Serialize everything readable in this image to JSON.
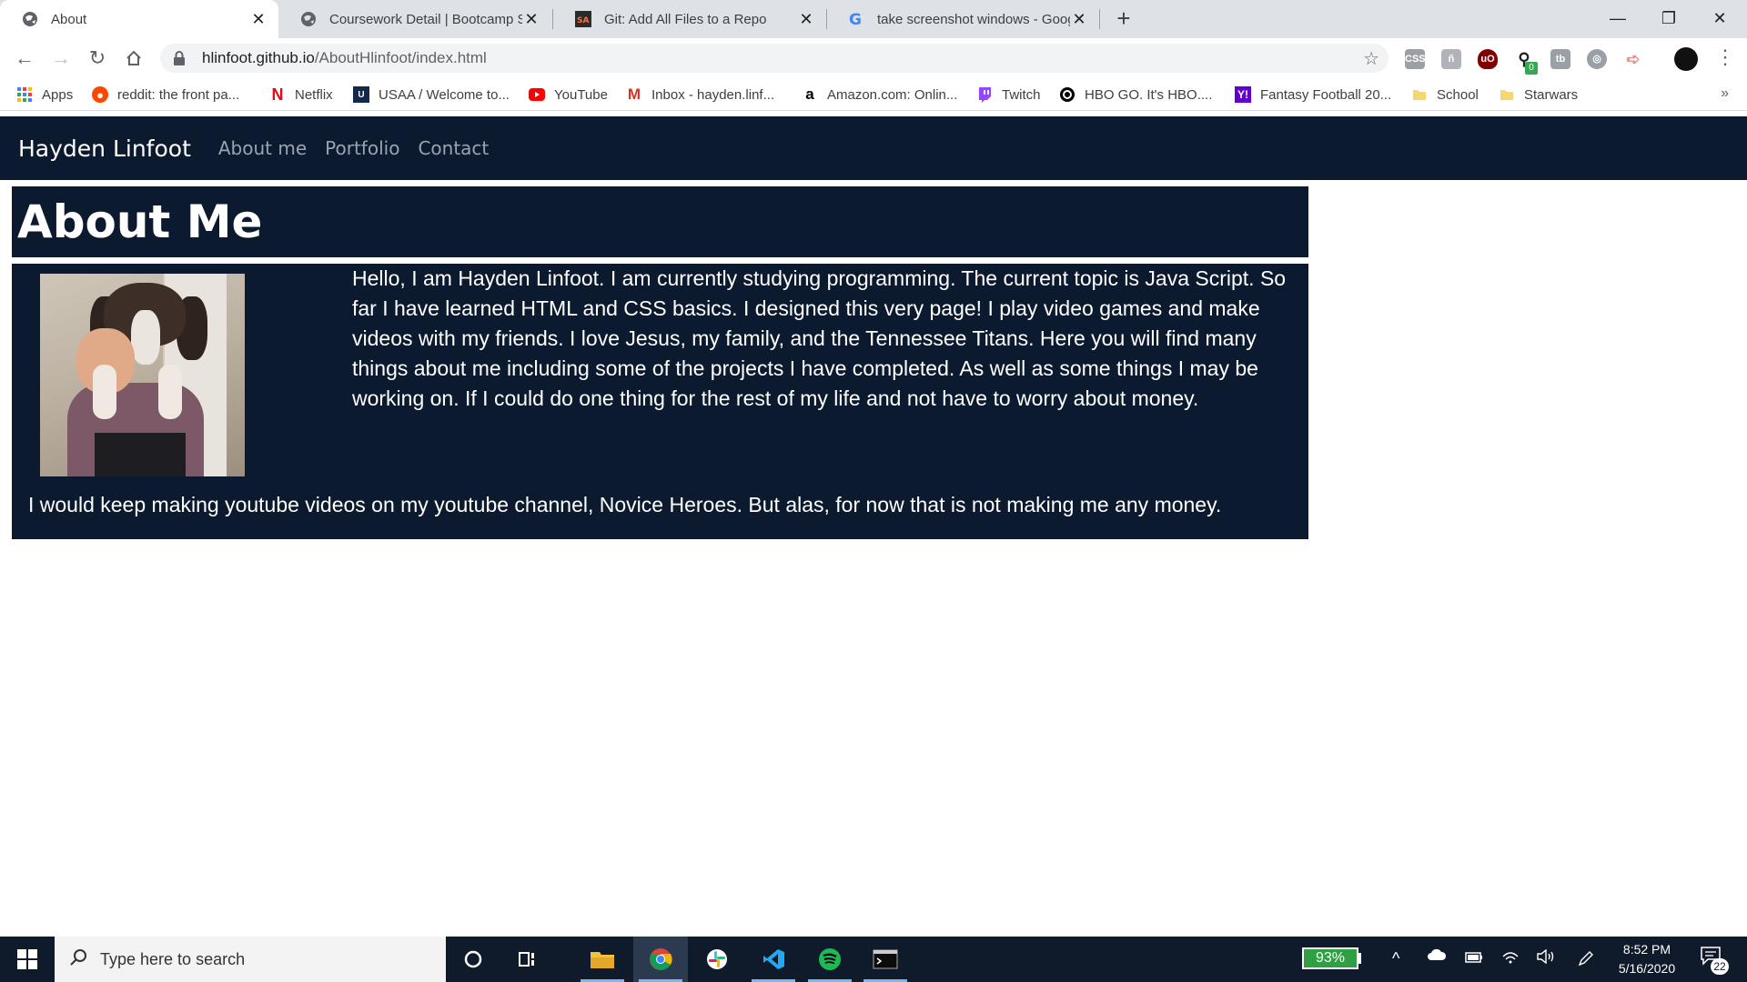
{
  "tabs": [
    {
      "title": "About",
      "active": true,
      "icon": "globe-icon"
    },
    {
      "title": "Coursework Detail | Bootcamp Sp",
      "active": false,
      "icon": "globe-icon"
    },
    {
      "title": "Git: Add All Files to a Repo",
      "active": false,
      "icon": "sa-icon"
    },
    {
      "title": "take screenshot windows - Goog",
      "active": false,
      "icon": "google-icon"
    }
  ],
  "tab_close_glyph": "✕",
  "new_tab_glyph": "+",
  "window": {
    "minimize": "—",
    "maximize": "❐",
    "close": "✕"
  },
  "address": {
    "host": "hlinfoot.github.io",
    "path": "/AboutHlinfoot/index.html"
  },
  "extensions": [
    {
      "name": "css-extension-icon",
      "color": "#9aa0a6",
      "label": "CSS"
    },
    {
      "name": "ext-icon",
      "color": "#b0b4b8",
      "label": "ñ"
    },
    {
      "name": "ublock-icon",
      "color": "#800000",
      "label": "uO"
    },
    {
      "name": "search-ext-icon",
      "color": "#202124",
      "label": "⚲"
    },
    {
      "name": "tb-ext-icon",
      "color": "#9aa0a6",
      "label": "tb"
    },
    {
      "name": "reel-ext-icon",
      "color": "#9aa0a6",
      "label": "◎"
    },
    {
      "name": "cast-ext-icon",
      "color": "#f28b82",
      "label": "➪"
    }
  ],
  "extension_badge": "0",
  "bookmarks": [
    {
      "label": "Apps",
      "icon": "apps-grid-icon",
      "color": "#4285f4"
    },
    {
      "label": "reddit: the front pa...",
      "icon": "reddit-icon",
      "color": "#ff4500"
    },
    {
      "label": "Netflix",
      "icon": "netflix-icon",
      "color": "#e50914"
    },
    {
      "label": "USAA / Welcome to...",
      "icon": "usaa-icon",
      "color": "#12284c"
    },
    {
      "label": "YouTube",
      "icon": "youtube-icon",
      "color": "#ff0000"
    },
    {
      "label": "Inbox - hayden.linf...",
      "icon": "gmail-icon",
      "color": "#d93025"
    },
    {
      "label": "Amazon.com: Onlin...",
      "icon": "amazon-icon",
      "color": "#000000"
    },
    {
      "label": "Twitch",
      "icon": "twitch-icon",
      "color": "#9146ff"
    },
    {
      "label": "HBO GO. It's HBO....",
      "icon": "hbo-icon",
      "color": "#000000"
    },
    {
      "label": "Fantasy Football 20...",
      "icon": "yahoo-icon",
      "color": "#6001d2"
    },
    {
      "label": "School",
      "icon": "folder-icon",
      "color": "#f9d66b"
    },
    {
      "label": "Starwars",
      "icon": "folder-icon",
      "color": "#f9d66b"
    }
  ],
  "bookmarks_more": "»",
  "site": {
    "brand": "Hayden Linfoot",
    "nav": [
      "About me",
      "Portfolio",
      "Contact"
    ],
    "heading": "About Me",
    "bio_part1": "Hello, I am Hayden Linfoot. I am currently studying programming. The current topic is Java Script. So far I have learned HTML and CSS basics. I designed this very page! I play video games and make videos with my friends. I love Jesus, my family, and the Tennessee Titans. Here you will find many things about me including some of the projects I have completed. As well as some things I may be working on. If I could do one thing for the rest of my life and not have to worry about money.",
    "bio_part2": "I would keep making youtube videos on my youtube channel, Novice Heroes. But alas, for now that is not making me any money."
  },
  "taskbar": {
    "search_placeholder": "Type here to search",
    "battery": "93%",
    "time": "8:52 PM",
    "date": "5/16/2020",
    "notification_count": "22",
    "apps": [
      "cortana-icon",
      "task-view-icon",
      "file-explorer-icon",
      "chrome-icon",
      "slack-icon",
      "vscode-icon",
      "spotify-icon",
      "terminal-icon"
    ]
  }
}
